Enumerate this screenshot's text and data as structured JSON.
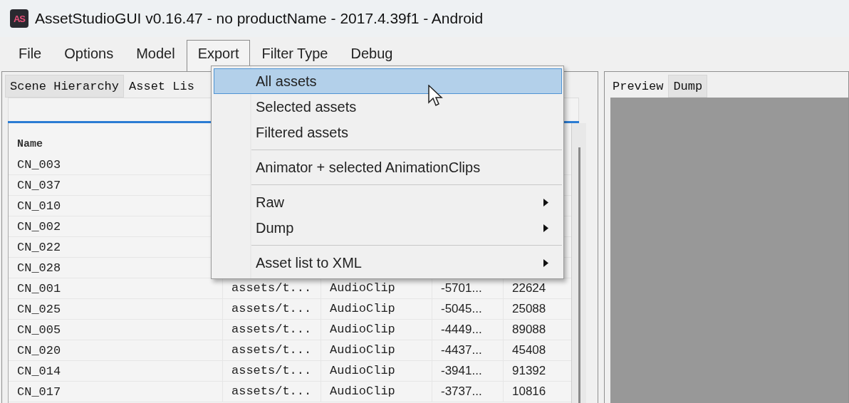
{
  "window": {
    "icon_text": "AS",
    "title": "AssetStudioGUI v0.16.47 - no productName - 2017.4.39f1 - Android"
  },
  "menu_bar": [
    {
      "label": "File",
      "open": false
    },
    {
      "label": "Options",
      "open": false
    },
    {
      "label": "Model",
      "open": false
    },
    {
      "label": "Export",
      "open": true
    },
    {
      "label": "Filter Type",
      "open": false
    },
    {
      "label": "Debug",
      "open": false
    }
  ],
  "left_panel": {
    "tabs": [
      {
        "label": "Scene Hierarchy",
        "selected": false
      },
      {
        "label": "Asset Lis",
        "selected": true
      }
    ],
    "table": {
      "columns": [
        "Name"
      ],
      "rows": [
        {
          "cells": [
            "CN_003"
          ]
        },
        {
          "cells": [
            "CN_037"
          ]
        },
        {
          "cells": [
            "CN_010"
          ]
        },
        {
          "cells": [
            "CN_002"
          ]
        },
        {
          "cells": [
            "CN_022"
          ]
        },
        {
          "cells": [
            "CN_028"
          ]
        },
        {
          "cells": [
            "CN_001",
            "assets/t...",
            "AudioClip",
            "-5701...",
            "22624"
          ]
        },
        {
          "cells": [
            "CN_025",
            "assets/t...",
            "AudioClip",
            "-5045...",
            "25088"
          ]
        },
        {
          "cells": [
            "CN_005",
            "assets/t...",
            "AudioClip",
            "-4449...",
            "89088"
          ]
        },
        {
          "cells": [
            "CN_020",
            "assets/t...",
            "AudioClip",
            "-4437...",
            "45408"
          ]
        },
        {
          "cells": [
            "CN_014",
            "assets/t...",
            "AudioClip",
            "-3941...",
            "91392"
          ]
        },
        {
          "cells": [
            "CN_017",
            "assets/t...",
            "AudioClip",
            "-3737...",
            "10816"
          ]
        }
      ]
    }
  },
  "right_panel": {
    "tabs": [
      {
        "label": "Preview",
        "selected": true
      },
      {
        "label": "Dump",
        "selected": false
      }
    ]
  },
  "export_menu": [
    {
      "kind": "item",
      "label": "All assets",
      "selected": true,
      "submenu": false
    },
    {
      "kind": "item",
      "label": "Selected assets",
      "selected": false,
      "submenu": false
    },
    {
      "kind": "item",
      "label": "Filtered assets",
      "selected": false,
      "submenu": false
    },
    {
      "kind": "separator"
    },
    {
      "kind": "item",
      "label": "Animator + selected AnimationClips",
      "selected": false,
      "submenu": false
    },
    {
      "kind": "separator"
    },
    {
      "kind": "item",
      "label": "Raw",
      "selected": false,
      "submenu": true
    },
    {
      "kind": "item",
      "label": "Dump",
      "selected": false,
      "submenu": true
    },
    {
      "kind": "separator"
    },
    {
      "kind": "item",
      "label": "Asset list to XML",
      "selected": false,
      "submenu": true
    }
  ]
}
